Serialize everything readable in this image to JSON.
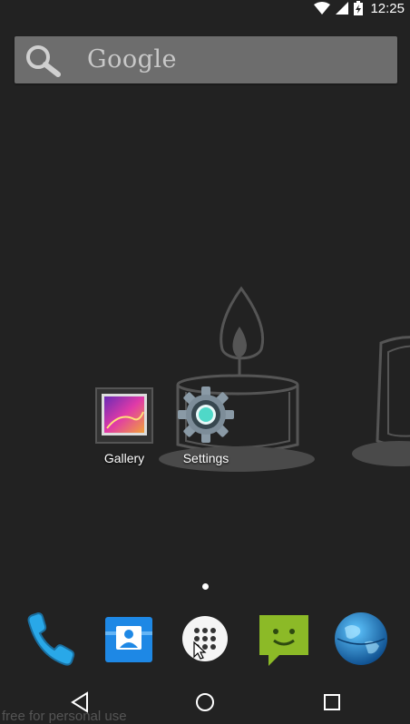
{
  "status_bar": {
    "time": "12:25",
    "icons": [
      "wifi-icon",
      "signal-icon",
      "battery-charging-icon"
    ]
  },
  "search": {
    "label": "Google"
  },
  "apps": [
    {
      "name": "gallery",
      "label": "Gallery",
      "icon": "gallery-icon"
    },
    {
      "name": "settings",
      "label": "Settings",
      "icon": "settings-gear-icon"
    }
  ],
  "dock": [
    {
      "name": "phone",
      "icon": "phone-icon"
    },
    {
      "name": "contacts",
      "icon": "contacts-icon"
    },
    {
      "name": "all-apps",
      "icon": "app-drawer-icon"
    },
    {
      "name": "messaging",
      "icon": "messaging-icon"
    },
    {
      "name": "browser",
      "icon": "globe-icon"
    }
  ],
  "navbar": [
    "back-icon",
    "home-icon",
    "recents-icon"
  ],
  "watermark": "free for personal use",
  "colors": {
    "background": "#222222",
    "search_bar": "#6d6d6d",
    "phone_blue": "#29a8e8",
    "messaging_green": "#8cba27"
  }
}
